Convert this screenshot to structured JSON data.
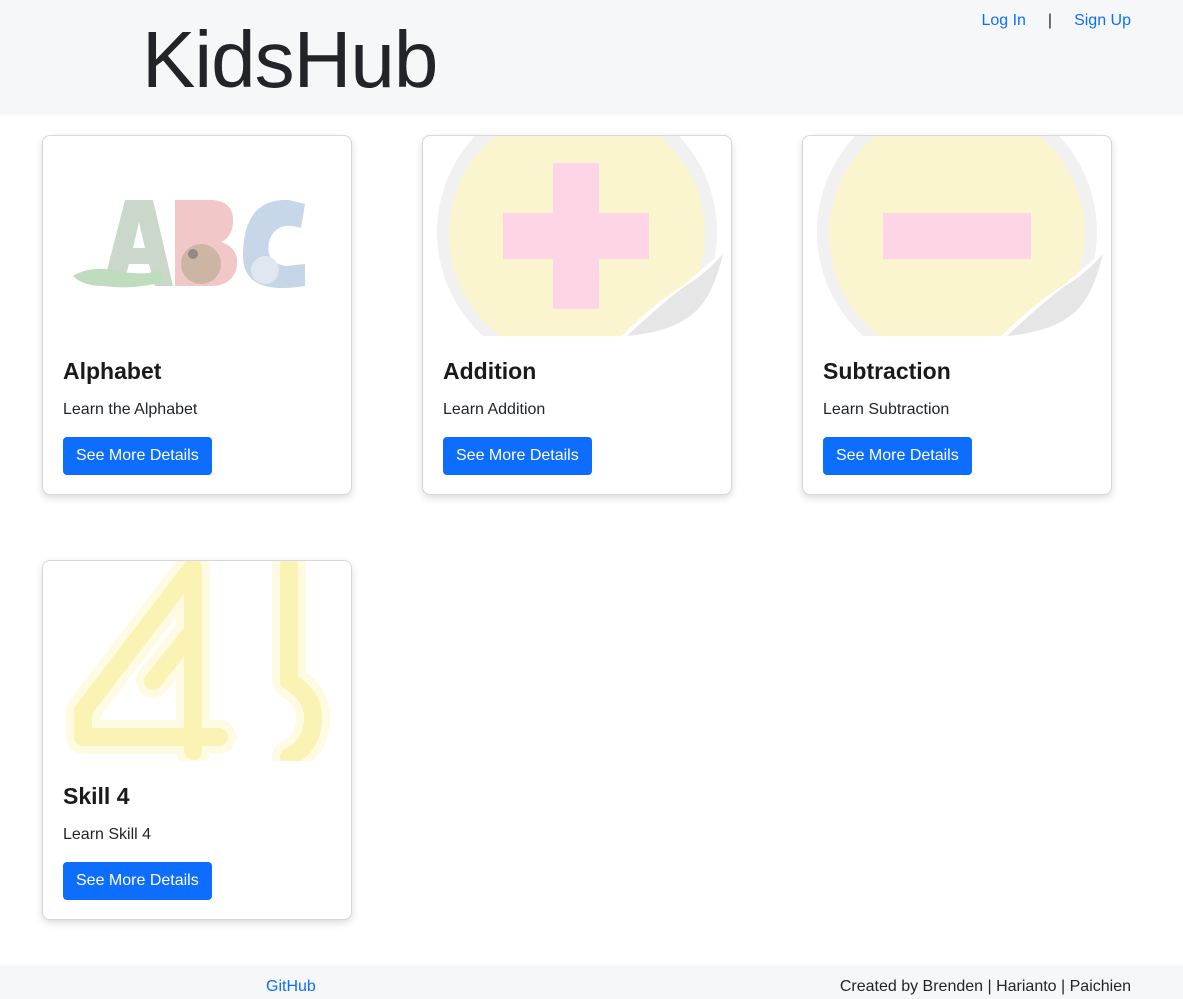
{
  "header": {
    "brand": "KidsHub",
    "login": "Log In",
    "separator": "|",
    "signup": "Sign Up"
  },
  "cards": [
    {
      "title": "Alphabet",
      "text": "Learn the Alphabet",
      "button": "See More Details",
      "image": "abc-letters-image"
    },
    {
      "title": "Addition",
      "text": "Learn Addition",
      "button": "See More Details",
      "image": "plus-sign-sticker-image"
    },
    {
      "title": "Subtraction",
      "text": "Learn Subtraction",
      "button": "See More Details",
      "image": "minus-sign-sticker-image"
    },
    {
      "title": "Skill 4",
      "text": "Learn Skill 4",
      "button": "See More Details",
      "image": "number-four-glow-image"
    }
  ],
  "footer": {
    "github": "GitHub",
    "credit": "Created by Brenden | Harianto | Paichien"
  },
  "colors": {
    "primary": "#0d6efd",
    "header_bg": "#f6f7f9",
    "sticker_yellow": "#fbf5cf",
    "sign_pink": "#fdd5e6"
  }
}
